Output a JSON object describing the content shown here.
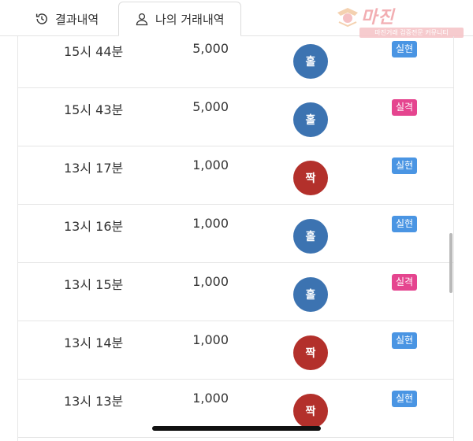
{
  "tabs": {
    "history": {
      "label": "결과내역",
      "icon": "history-icon"
    },
    "my_trades": {
      "label": "나의 거래내역",
      "icon": "user-icon",
      "active": true
    }
  },
  "watermark": {
    "title": "마진",
    "sub": "마진거래 검증전문 커뮤니티"
  },
  "colors": {
    "odd": "#3c73b1",
    "even": "#b3302b",
    "win": "#4a95e3",
    "lose": "#e5458f"
  },
  "rows": [
    {
      "time": "15시 44분",
      "amount": "5,000",
      "pick": "홀",
      "pick_type": "odd",
      "result": "실현",
      "result_type": "win"
    },
    {
      "time": "15시 43분",
      "amount": "5,000",
      "pick": "홀",
      "pick_type": "odd",
      "result": "실격",
      "result_type": "lose"
    },
    {
      "time": "13시 17분",
      "amount": "1,000",
      "pick": "짝",
      "pick_type": "even",
      "result": "실현",
      "result_type": "win"
    },
    {
      "time": "13시 16분",
      "amount": "1,000",
      "pick": "홀",
      "pick_type": "odd",
      "result": "실현",
      "result_type": "win"
    },
    {
      "time": "13시 15분",
      "amount": "1,000",
      "pick": "홀",
      "pick_type": "odd",
      "result": "실격",
      "result_type": "lose"
    },
    {
      "time": "13시 14분",
      "amount": "1,000",
      "pick": "짝",
      "pick_type": "even",
      "result": "실현",
      "result_type": "win"
    },
    {
      "time": "13시 13분",
      "amount": "1,000",
      "pick": "짝",
      "pick_type": "even",
      "result": "실현",
      "result_type": "win"
    }
  ]
}
